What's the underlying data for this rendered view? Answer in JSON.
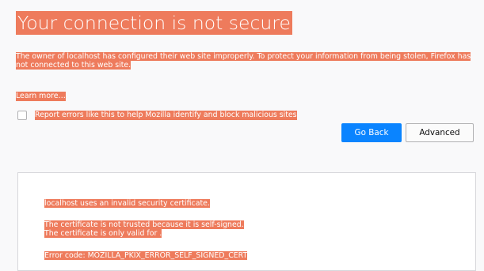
{
  "error_page": {
    "title": "Your connection is not secure",
    "description": "The owner of localhost has configured their web site improperly. To protect your information from being stolen, Firefox has not connected to this web site.",
    "learn_more": "Learn more…",
    "report_checkbox": {
      "label": "Report errors like this to help Mozilla identify and block malicious sites",
      "checked": false
    },
    "buttons": {
      "go_back": "Go Back",
      "advanced": "Advanced"
    }
  },
  "advanced_panel": {
    "invalid_cert": "localhost uses an invalid security certificate.",
    "not_trusted": "The certificate is not trusted because it is self-signed.",
    "only_valid_for": "The certificate is only valid for .",
    "error_code": "Error code: MOZILLA_PKIX_ERROR_SELF_SIGNED_CERT"
  },
  "colors": {
    "highlight": "#ee7b5c",
    "primary_button": "#0a84ff",
    "background": "#f9f9fa"
  }
}
